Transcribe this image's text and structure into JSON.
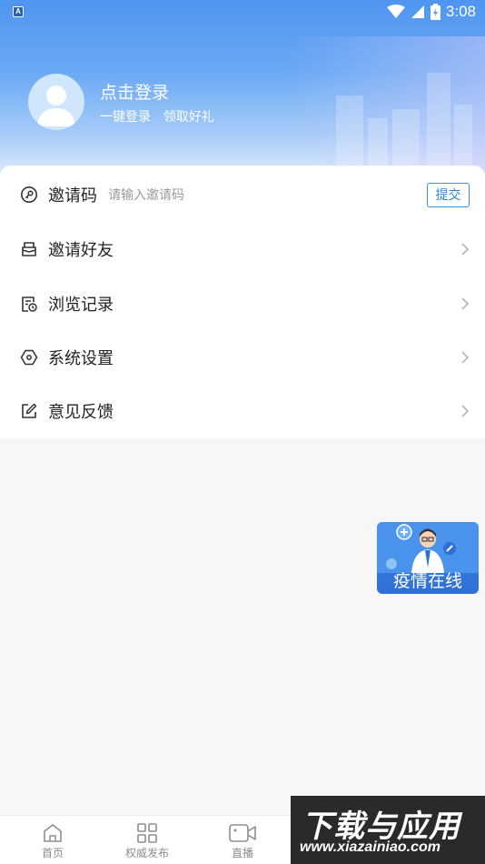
{
  "status_bar": {
    "app_icon_letter": "A",
    "time": "3:08"
  },
  "profile": {
    "title": "点击登录",
    "subtitle_1": "一键登录",
    "subtitle_2": "领取好礼"
  },
  "invite": {
    "label": "邀请码",
    "placeholder": "请输入邀请码",
    "value": "",
    "submit_label": "提交"
  },
  "menu": {
    "items": [
      {
        "label": "邀请好友",
        "icon": "envelope-icon"
      },
      {
        "label": "浏览记录",
        "icon": "history-icon"
      },
      {
        "label": "系统设置",
        "icon": "settings-hexagon-icon"
      },
      {
        "label": "意见反馈",
        "icon": "edit-icon"
      }
    ]
  },
  "floating_card": {
    "label": "疫情在线"
  },
  "bottom_nav": {
    "items": [
      {
        "label": "首页",
        "icon": "home-icon"
      },
      {
        "label": "权威发布",
        "icon": "grid-icon"
      },
      {
        "label": "直播",
        "icon": "video-camera-icon"
      }
    ]
  },
  "watermark": {
    "title": "下载与应用",
    "url": "www.xiazainiao.com"
  },
  "colors": {
    "header_blue": "#4f95f0",
    "accent_blue": "#2f86cf",
    "float_card_blue": "#2f6fd6"
  }
}
